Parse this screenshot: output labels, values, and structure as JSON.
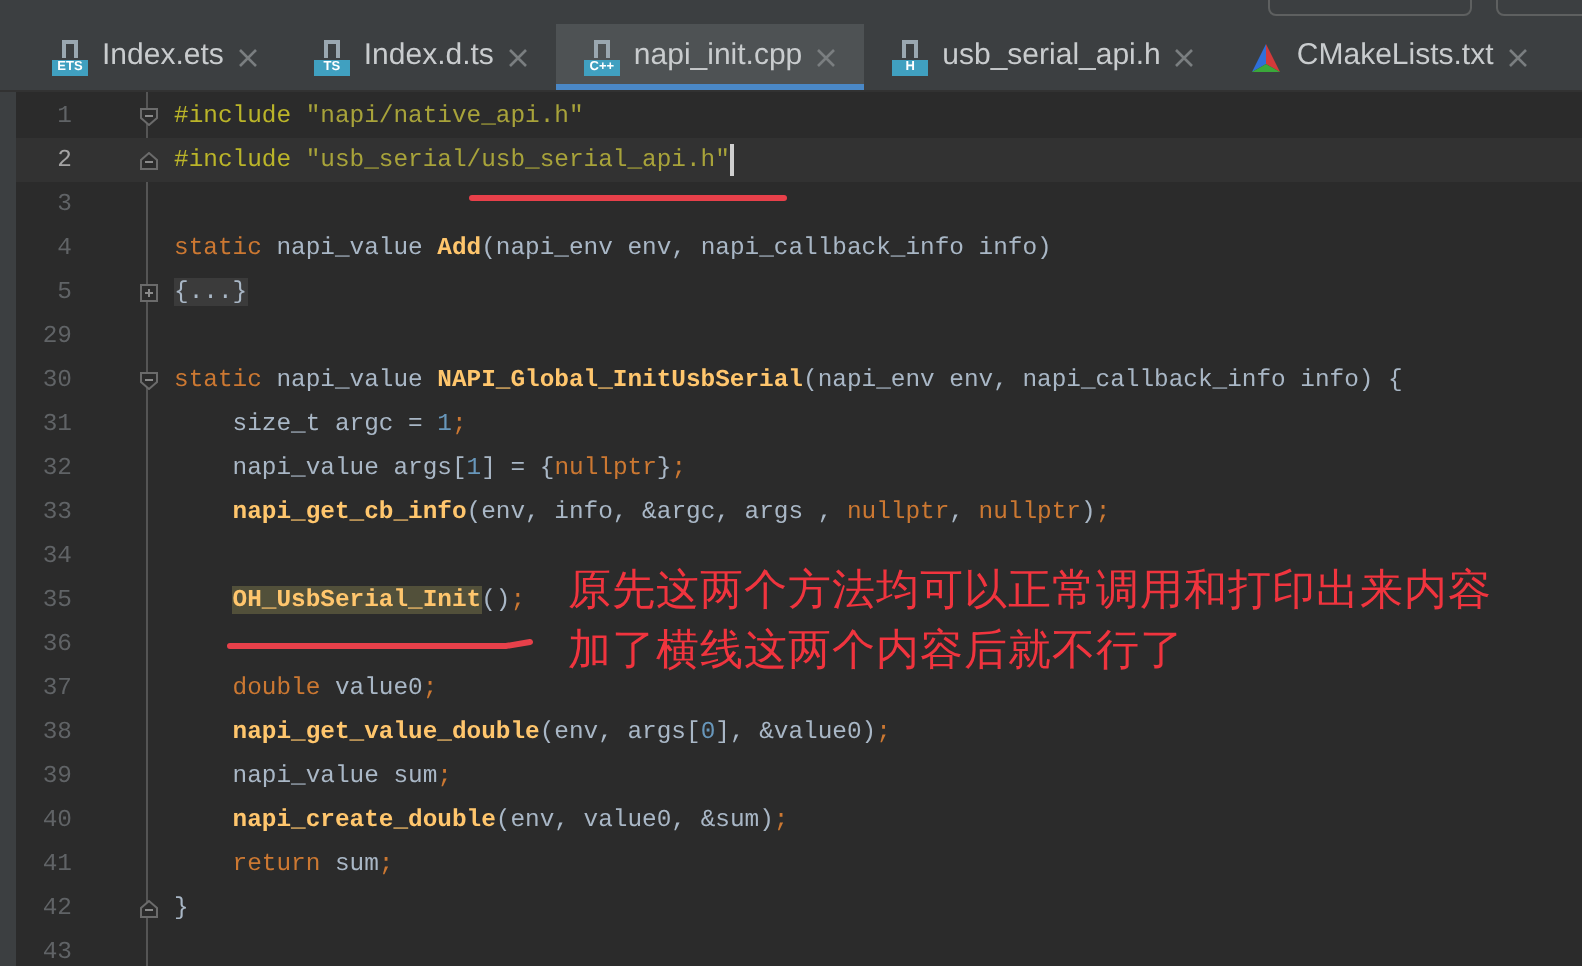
{
  "tabs": [
    {
      "label": "Index.ets",
      "kind": "file",
      "icon_label": "ETS",
      "selected": false
    },
    {
      "label": "Index.d.ts",
      "kind": "file",
      "icon_label": "TS",
      "selected": false
    },
    {
      "label": "napi_init.cpp",
      "kind": "file",
      "icon_label": "C++",
      "selected": true
    },
    {
      "label": "usb_serial_api.h",
      "kind": "file",
      "icon_label": "H",
      "selected": false
    },
    {
      "label": "CMakeLists.txt",
      "kind": "cmake",
      "selected": false
    }
  ],
  "editor": {
    "lines": [
      {
        "number": "1",
        "current": false,
        "kind": "fold-start",
        "segments": [
          {
            "kind": "macro",
            "text": "#include "
          },
          {
            "kind": "string",
            "text": "\"napi/native_api.h\""
          }
        ]
      },
      {
        "number": "2",
        "current": true,
        "kind": "fold-end",
        "segments": [
          {
            "kind": "macro",
            "text": "#include "
          },
          {
            "kind": "string",
            "text": "\"usb_serial/usb_serial_api.h\""
          }
        ]
      },
      {
        "number": "3",
        "current": false
      },
      {
        "number": "4",
        "current": false,
        "segments": [
          {
            "kind": "keyword",
            "text": "static "
          },
          {
            "kind": "plain",
            "text": "napi_value "
          },
          {
            "kind": "function",
            "text": "Add"
          },
          {
            "kind": "plain",
            "text": "(napi_env env, napi_callback_info info)"
          }
        ]
      },
      {
        "number": "5",
        "current": false,
        "kind": "fold-collapsed",
        "segments": [
          {
            "kind": "folded",
            "text": "{...}"
          }
        ]
      },
      {
        "number": "29",
        "current": false
      },
      {
        "number": "30",
        "current": false,
        "kind": "fold-start",
        "segments": [
          {
            "kind": "keyword",
            "text": "static "
          },
          {
            "kind": "plain",
            "text": "napi_value "
          },
          {
            "kind": "function",
            "text": "NAPI_Global_InitUsbSerial"
          },
          {
            "kind": "plain",
            "text": "(napi_env env, napi_callback_info info) {"
          }
        ]
      },
      {
        "number": "31",
        "current": false,
        "segments": [
          {
            "kind": "plain",
            "text": "    size_t argc = "
          },
          {
            "kind": "number",
            "text": "1"
          },
          {
            "kind": "keyword",
            "text": ";"
          }
        ]
      },
      {
        "number": "32",
        "current": false,
        "segments": [
          {
            "kind": "plain",
            "text": "    napi_value args["
          },
          {
            "kind": "number",
            "text": "1"
          },
          {
            "kind": "plain",
            "text": "] = {"
          },
          {
            "kind": "keyword",
            "text": "nullptr"
          },
          {
            "kind": "plain",
            "text": "}"
          },
          {
            "kind": "keyword",
            "text": ";"
          }
        ]
      },
      {
        "number": "33",
        "current": false,
        "segments": [
          {
            "kind": "function",
            "text": "    napi_get_cb_info"
          },
          {
            "kind": "plain",
            "text": "(env, info, &argc, args , "
          },
          {
            "kind": "keyword",
            "text": "nullptr"
          },
          {
            "kind": "plain",
            "text": ", "
          },
          {
            "kind": "keyword",
            "text": "nullptr"
          },
          {
            "kind": "plain",
            "text": ")"
          },
          {
            "kind": "keyword",
            "text": ";"
          }
        ]
      },
      {
        "number": "34",
        "current": false
      },
      {
        "number": "35",
        "current": false,
        "segments": [
          {
            "kind": "highlighted",
            "text": "    OH_UsbSerial_Init"
          },
          {
            "kind": "plain",
            "text": "()"
          },
          {
            "kind": "keyword",
            "text": ";"
          }
        ]
      },
      {
        "number": "36",
        "current": false
      },
      {
        "number": "37",
        "current": false,
        "segments": [
          {
            "kind": "keyword",
            "text": "    double "
          },
          {
            "kind": "plain",
            "text": "value0"
          },
          {
            "kind": "keyword",
            "text": ";"
          }
        ]
      },
      {
        "number": "38",
        "current": false,
        "segments": [
          {
            "kind": "function",
            "text": "    napi_get_value_double"
          },
          {
            "kind": "plain",
            "text": "(env, args["
          },
          {
            "kind": "number",
            "text": "0"
          },
          {
            "kind": "plain",
            "text": "], &value0)"
          },
          {
            "kind": "keyword",
            "text": ";"
          }
        ]
      },
      {
        "number": "39",
        "current": false,
        "segments": [
          {
            "kind": "plain",
            "text": "    napi_value sum"
          },
          {
            "kind": "keyword",
            "text": ";"
          }
        ]
      },
      {
        "number": "40",
        "current": false,
        "segments": [
          {
            "kind": "function",
            "text": "    napi_create_double"
          },
          {
            "kind": "plain",
            "text": "(env, value0, &sum)"
          },
          {
            "kind": "keyword",
            "text": ";"
          }
        ]
      },
      {
        "number": "41",
        "current": false,
        "segments": [
          {
            "kind": "keyword",
            "text": "    return "
          },
          {
            "kind": "plain",
            "text": "sum"
          },
          {
            "kind": "keyword",
            "text": ";"
          }
        ]
      },
      {
        "number": "42",
        "current": false,
        "kind": "fold-end",
        "segments": [
          {
            "kind": "plain",
            "text": "}"
          }
        ]
      },
      {
        "number": "43",
        "current": false
      }
    ]
  },
  "annotation": {
    "lines": [
      "原先这两个方法均可以正常调用和打印出来内容",
      "加了横线这两个内容后就不行了"
    ]
  }
}
